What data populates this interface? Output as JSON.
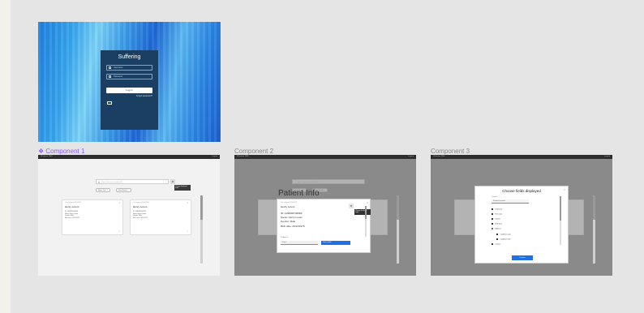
{
  "login": {
    "title": "Suffering",
    "username_placeholder": "Username",
    "password_placeholder": "Password",
    "login_label": "Log in",
    "forgot_label": "Forgot password?"
  },
  "components": [
    {
      "label": "❖ Component 1"
    },
    {
      "label": "Component 2"
    },
    {
      "label": "Component 3"
    }
  ],
  "app": {
    "brand": "Whatever PMS",
    "logout": "Logout",
    "search_placeholder": "Search by name or patient ID",
    "gear_tooltip": "Change displayed fields",
    "chips": [
      "Henry Doe ⓧ",
      "Jane Smith ⓧ"
    ],
    "cards": [
      {
        "small": "Last updated 01/05/2024",
        "name": "Henry Lorem",
        "details": [
          "ID: 1438283746583",
          "Name: Henry Lorem",
          "Gender: Male",
          "Birth date: 09/12/1978"
        ]
      },
      {
        "small": "Last updated 01/05/2024",
        "name": "Henry Lorem",
        "details": [
          "ID: 1438283746583",
          "Name: Henry Lorem",
          "Gender: Male",
          "Birth date: 09/12/1978"
        ]
      }
    ]
  },
  "patient_modal": {
    "heading": "Patient Info",
    "small": "Last updated 01/05/2024",
    "name": "Henry Lorem",
    "details": [
      "ID: 1438283746583",
      "Name: Henry Lorem",
      "Gender: Male",
      "Birth date: 09/12/1978"
    ],
    "tooltip": "Change displayed fields",
    "select_label": "Display as",
    "select_value": "Card",
    "button": "Save visible"
  },
  "fields_modal": {
    "title": "Choose fields displayed",
    "select_label": "Template",
    "select_value": "Pinned to patient",
    "items": [
      {
        "label": "Patient ID",
        "checked": true,
        "radio": false,
        "indent": false
      },
      {
        "label": "Full name",
        "checked": true,
        "radio": false,
        "indent": false
      },
      {
        "label": "Gender",
        "checked": true,
        "radio": false,
        "indent": false
      },
      {
        "label": "Birth date",
        "checked": true,
        "radio": false,
        "indent": false
      },
      {
        "label": "Address",
        "checked": false,
        "radio": true,
        "indent": false
      },
      {
        "label": "Condition Lines",
        "checked": false,
        "radio": false,
        "indent": true
      },
      {
        "label": "Condition Start",
        "checked": true,
        "radio": false,
        "indent": true
      },
      {
        "label": "Contact",
        "checked": false,
        "radio": false,
        "indent": false
      }
    ],
    "button": "Confirm"
  }
}
